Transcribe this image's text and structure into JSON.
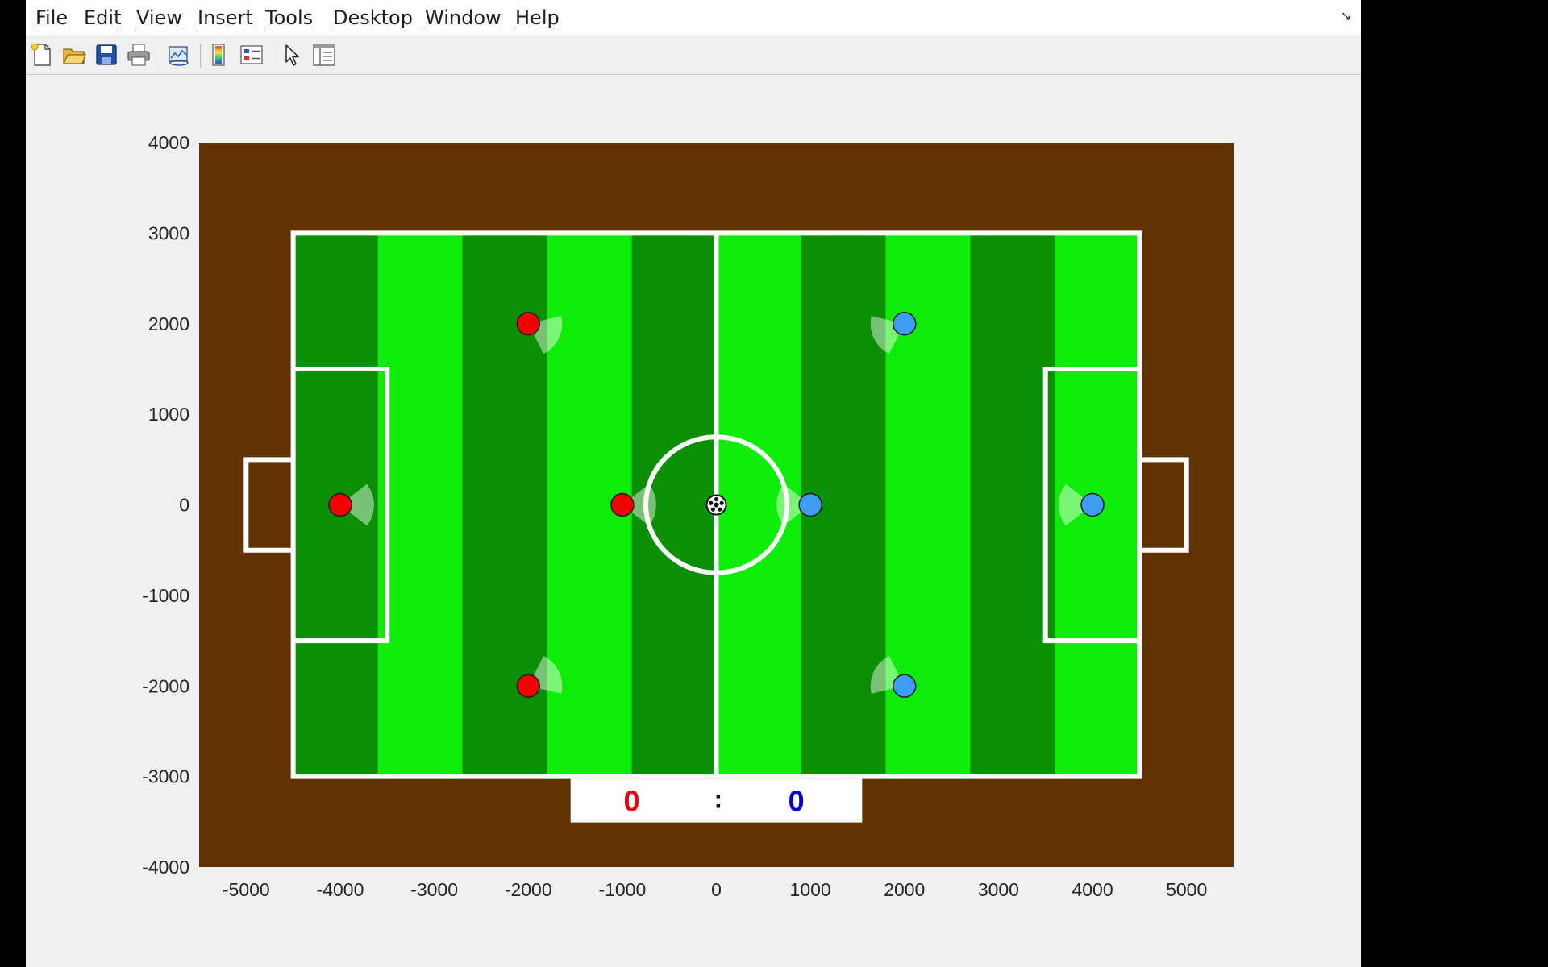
{
  "menu": [
    {
      "label": "File"
    },
    {
      "label": "Edit"
    },
    {
      "label": "View"
    },
    {
      "label": "Insert"
    },
    {
      "label": "Tools"
    },
    {
      "label": "Desktop"
    },
    {
      "label": "Window"
    },
    {
      "label": "Help"
    }
  ],
  "toolbar": [
    {
      "icon": "new-file-icon"
    },
    {
      "icon": "open-folder-icon"
    },
    {
      "icon": "save-icon"
    },
    {
      "icon": "print-icon"
    },
    {
      "icon": "link-plot-icon"
    },
    {
      "icon": "colorbar-icon"
    },
    {
      "icon": "legend-icon"
    },
    {
      "icon": "pointer-icon"
    },
    {
      "icon": "property-inspector-icon"
    }
  ],
  "axes": {
    "xlim": [
      -5500,
      5500
    ],
    "ylim": [
      -4000,
      4000
    ],
    "xticks": [
      "-5000",
      "-4000",
      "-3000",
      "-2000",
      "-1000",
      "0",
      "1000",
      "2000",
      "3000",
      "4000",
      "5000"
    ],
    "yticks": [
      "4000",
      "3000",
      "2000",
      "1000",
      "0",
      "-1000",
      "-2000",
      "-3000",
      "-4000"
    ]
  },
  "field": {
    "background_color": "#613300",
    "stripe_dark": "#0a8f05",
    "stripe_light": "#0ded07",
    "line_color": "#ffffff",
    "bounds": {
      "x": [
        -4500,
        4500
      ],
      "y": [
        -3000,
        3000
      ]
    },
    "center_circle_radius": 750,
    "penalty_box": {
      "depth": 1000,
      "half_width": 1500
    },
    "goal": {
      "depth": 500,
      "half_width": 500
    }
  },
  "robots": [
    {
      "team": "red",
      "x": -4000,
      "y": 0,
      "heading": 0
    },
    {
      "team": "red",
      "x": -1000,
      "y": 0,
      "heading": 0
    },
    {
      "team": "red",
      "x": -2000,
      "y": 2000,
      "heading": -25
    },
    {
      "team": "red",
      "x": -2000,
      "y": -2000,
      "heading": 25
    },
    {
      "team": "blue",
      "x": 1000,
      "y": 0,
      "heading": 180
    },
    {
      "team": "blue",
      "x": 4000,
      "y": 0,
      "heading": 180
    },
    {
      "team": "blue",
      "x": 2000,
      "y": 2000,
      "heading": 205
    },
    {
      "team": "blue",
      "x": 2000,
      "y": -2000,
      "heading": 155
    }
  ],
  "team_colors": {
    "red": "#f00000",
    "blue": "#3d9df5"
  },
  "ball": {
    "x": 0,
    "y": 0
  },
  "scoreboard": {
    "red_score": "0",
    "separator": ":",
    "blue_score": "0",
    "red_color": "#e8000b",
    "blue_color": "#0000dd"
  }
}
